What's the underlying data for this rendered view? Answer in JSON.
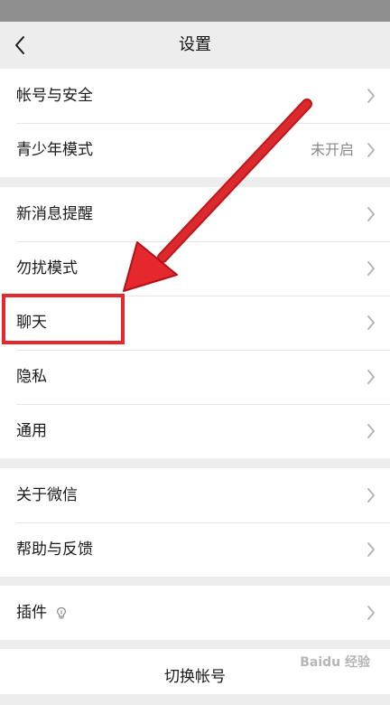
{
  "nav": {
    "title": "设置",
    "back_icon": "chevron-left-icon"
  },
  "groups": [
    {
      "items": [
        {
          "label": "帐号与安全",
          "value": ""
        },
        {
          "label": "青少年模式",
          "value": "未开启"
        }
      ]
    },
    {
      "items": [
        {
          "label": "新消息提醒",
          "value": ""
        },
        {
          "label": "勿扰模式",
          "value": ""
        },
        {
          "label": "聊天",
          "value": ""
        },
        {
          "label": "隐私",
          "value": ""
        },
        {
          "label": "通用",
          "value": ""
        }
      ]
    },
    {
      "items": [
        {
          "label": "关于微信",
          "value": ""
        },
        {
          "label": "帮助与反馈",
          "value": ""
        }
      ]
    },
    {
      "items": [
        {
          "label": "插件",
          "value": "",
          "badge_icon": "bulb-icon"
        }
      ]
    }
  ],
  "footer": {
    "switch_account": "切换帐号"
  },
  "annotation": {
    "highlight_color": "#e5282e",
    "highlighted_item": "聊天"
  },
  "watermark": "Baidu 经验"
}
